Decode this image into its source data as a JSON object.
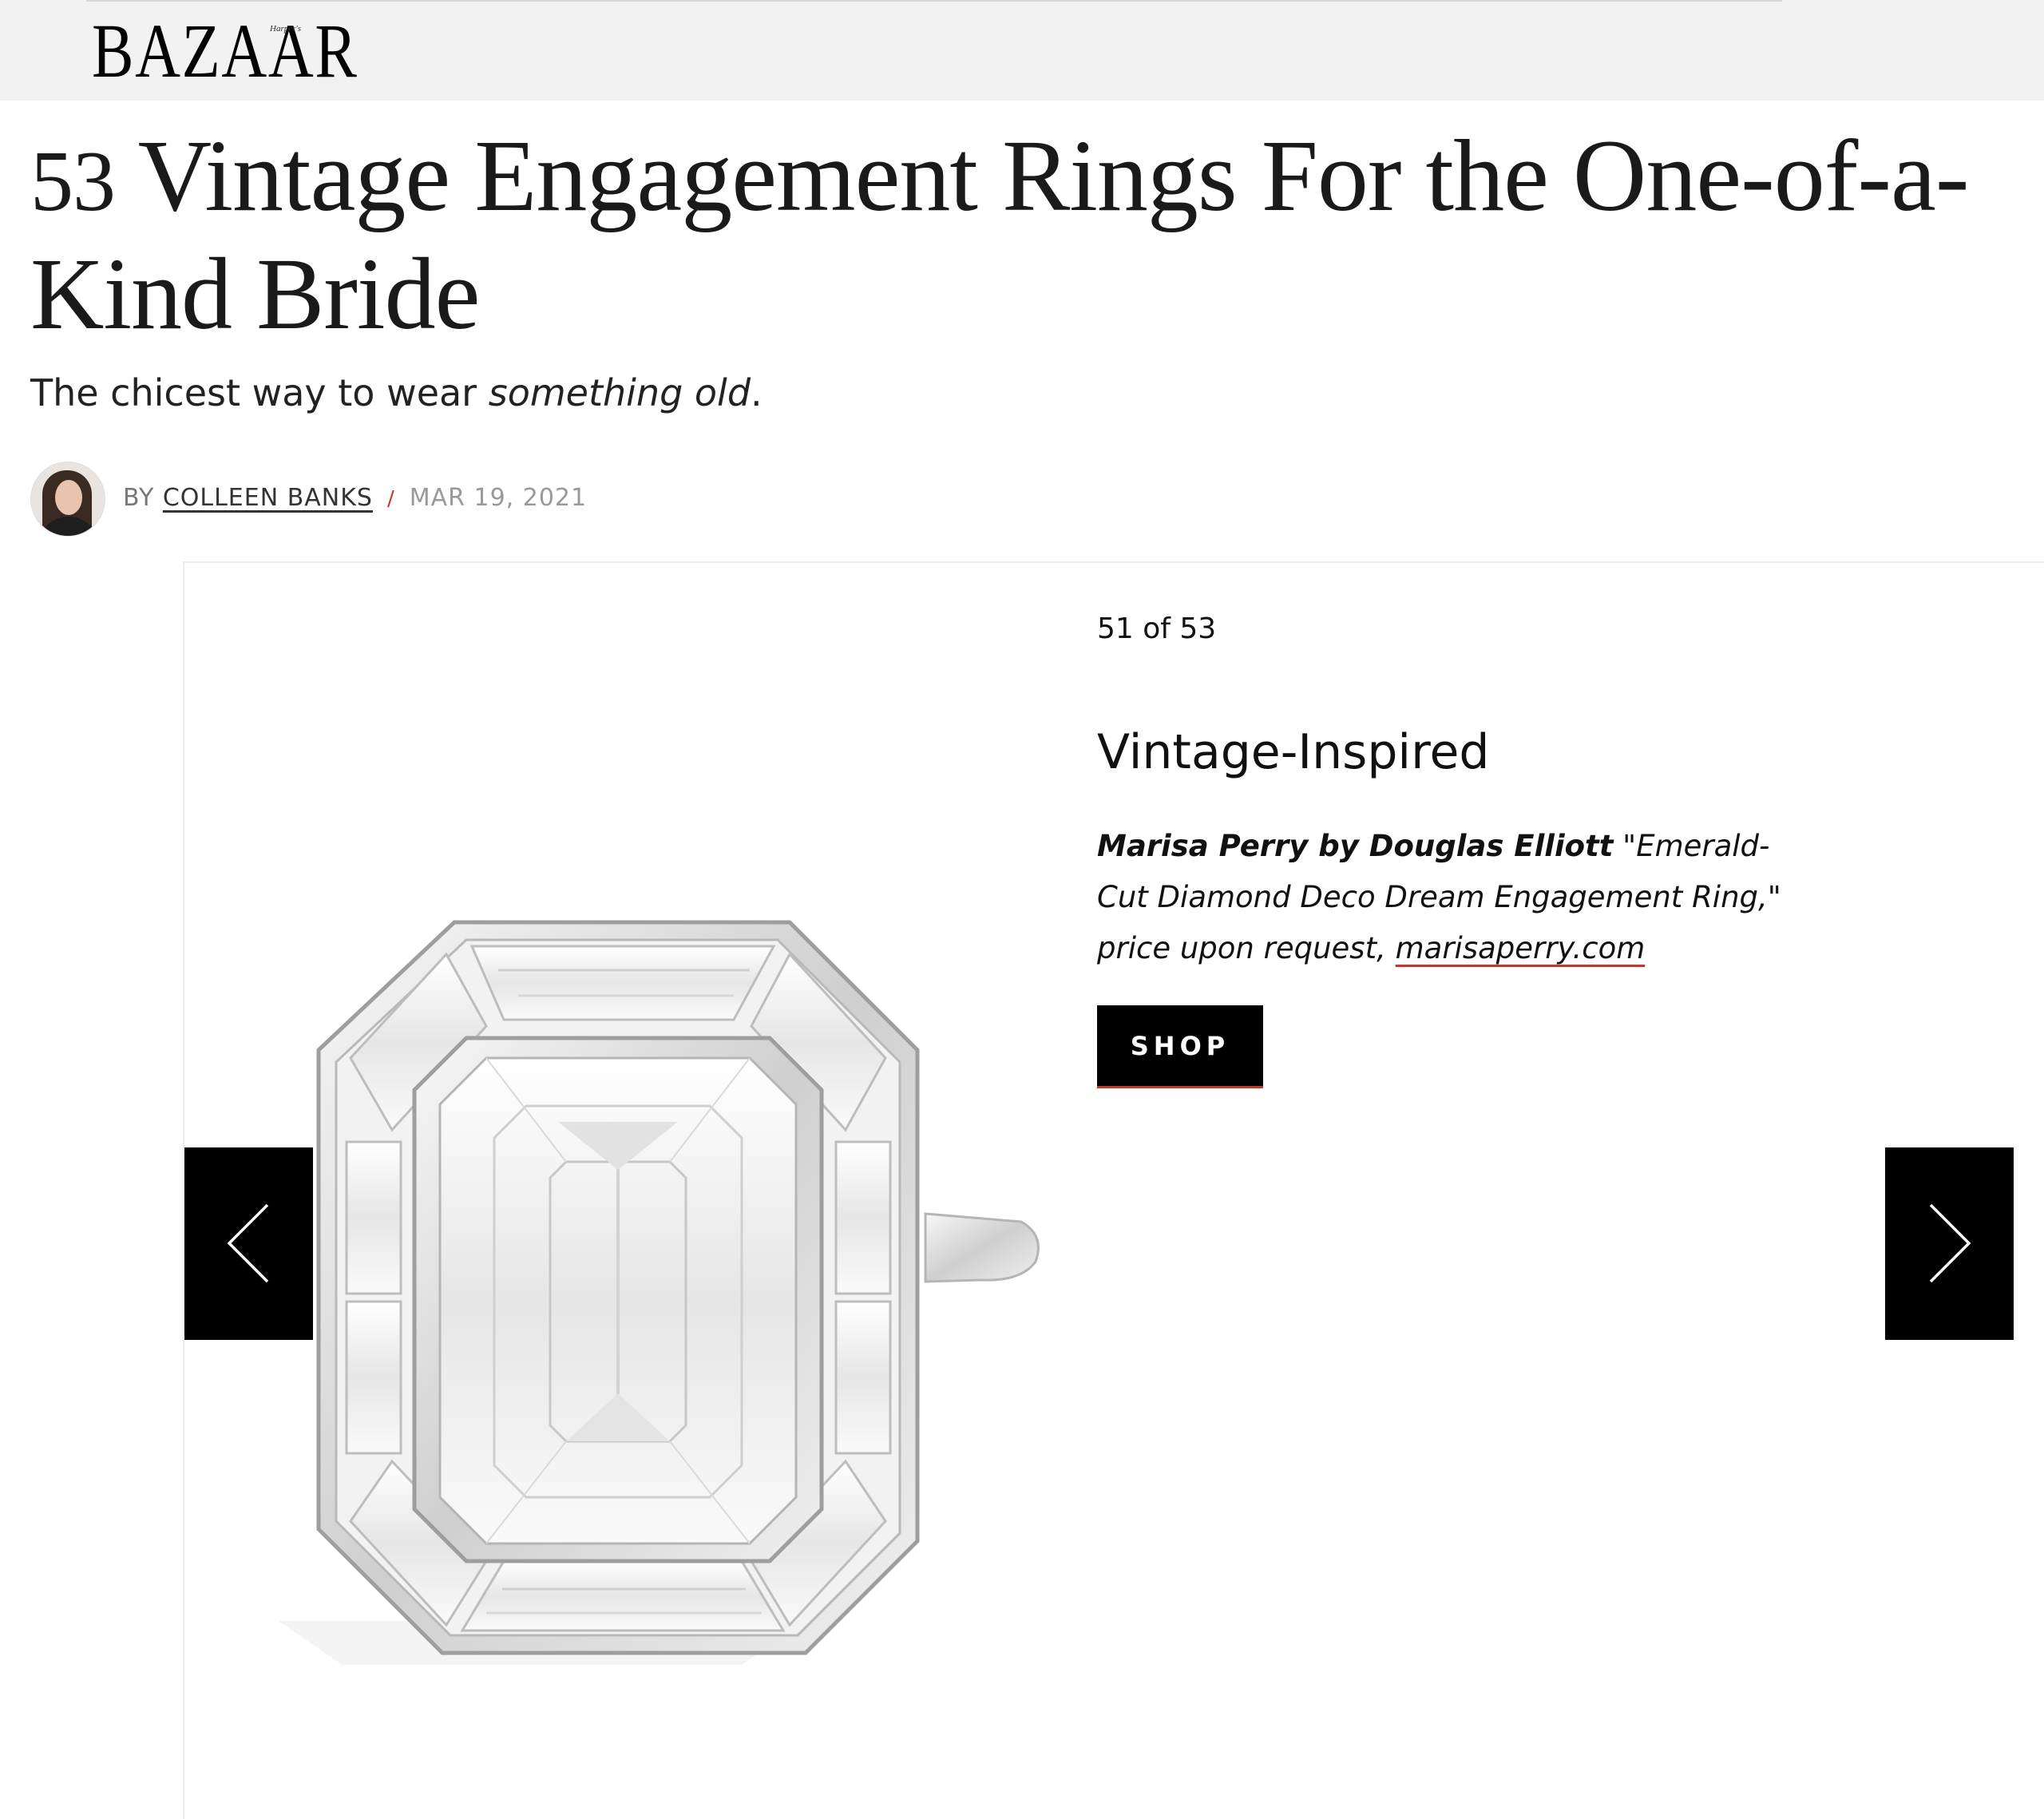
{
  "header": {
    "logo_text": "BAZAAR",
    "logo_small_text": "Harper's"
  },
  "article": {
    "headline_number": "53",
    "headline_text": "Vintage Engagement Rings For the One-of-a-Kind Bride",
    "dek_plain": "The chicest way to wear ",
    "dek_italic": "something old",
    "dek_end": "."
  },
  "byline": {
    "prefix": "BY ",
    "author": "COLLEEN BANKS",
    "separator": "/",
    "date": "MAR 19, 2021"
  },
  "gallery": {
    "counter": "51 of 53",
    "slide_title": "Vintage-Inspired",
    "caption_brand": "Marisa Perry by Douglas Elliott",
    "caption_text": " \"Emerald-Cut Diamond Deco Dream Engagement Ring,\" price upon request, ",
    "caption_link": "marisaperry.com",
    "shop_label": "SHOP",
    "prev_icon": "chevron-left-icon",
    "next_icon": "chevron-right-icon"
  },
  "colors": {
    "accent": "#c0392b",
    "header_bg": "#f2f2f2",
    "button_bg": "#000000"
  }
}
